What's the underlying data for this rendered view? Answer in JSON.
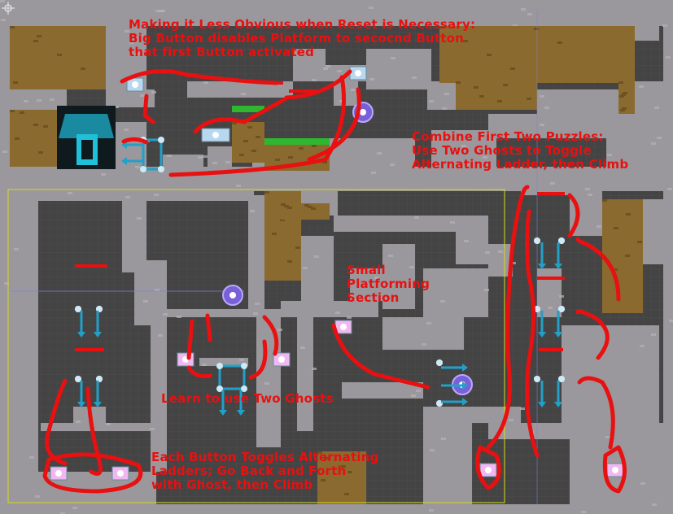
{
  "colors": {
    "wall": "#9a989c",
    "wall_spot": "#b4b2b6",
    "background": "#444444",
    "dirt": "#8a6a2e",
    "dirt_dark": "#6e5222",
    "grass": "#2fb82f",
    "annotation_red": "#e81010",
    "ladder_cyan": "#22a0c8",
    "ghost_purple": "#7a60d8",
    "button_pink": "#f0b8f0",
    "selection_yellow": "#d8d820"
  },
  "annotations": {
    "reset_note": "Making it Less Obvious when Reset is Necessary:\nBig Button disables Platform to secocnd Button\nthat first Button activated",
    "combine_note": "Combine First Two Puzzles:\nUse Two Ghosts to Toggle\nAlternating Ladder, then Climb",
    "platforming_note": "Small\nPlatforming\nSection",
    "two_ghosts_note": "Learn to use Two Ghosts",
    "alternating_note": "Each Button Toggles Alternating\nLadders; Go Back and Forth\nwith Ghost, then Climb"
  },
  "icons": {
    "move_handle": "crosshair-handle-icon",
    "exit_door": "exit-door-icon",
    "ghost": "ghost-orb-icon",
    "button": "pressure-button-icon",
    "ladder": "toggle-ladder-icon"
  }
}
